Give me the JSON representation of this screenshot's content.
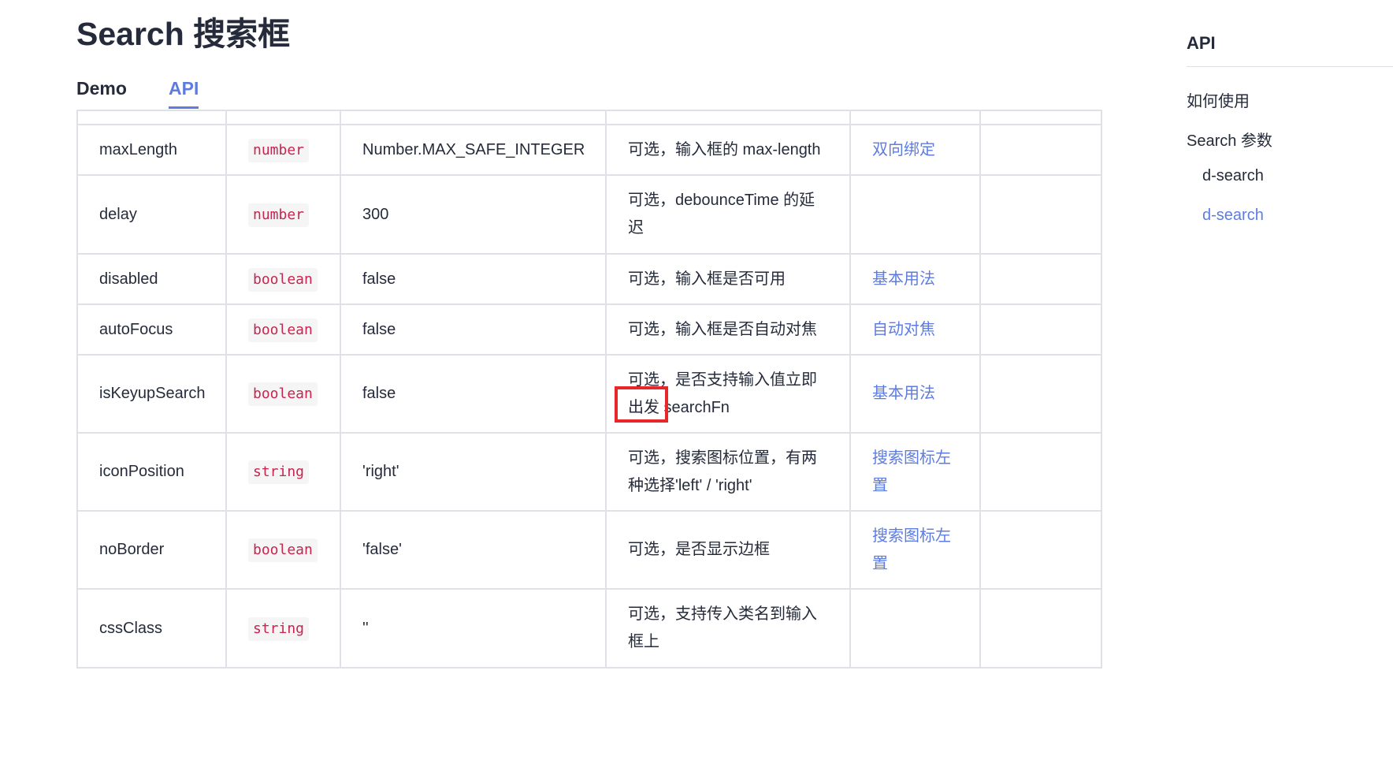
{
  "page": {
    "title": "Search 搜索框"
  },
  "tabs": [
    {
      "label": "Demo",
      "active": false
    },
    {
      "label": "API",
      "active": true
    }
  ],
  "api_table": {
    "rows": [
      {
        "param": "maxLength",
        "type": "number",
        "default": "Number.MAX_SAFE_INTEGER",
        "desc": "可选，输入框的 max-length",
        "demo": "双向绑定"
      },
      {
        "param": "delay",
        "type": "number",
        "default": "300",
        "desc": "可选，debounceTime 的延迟",
        "demo": ""
      },
      {
        "param": "disabled",
        "type": "boolean",
        "default": "false",
        "desc": "可选，输入框是否可用",
        "demo": "基本用法"
      },
      {
        "param": "autoFocus",
        "type": "boolean",
        "default": "false",
        "desc": "可选，输入框是否自动对焦",
        "demo": "自动对焦"
      },
      {
        "param": "isKeyupSearch",
        "type": "boolean",
        "default": "false",
        "desc": "可选，是否支持输入值立即出发 searchFn",
        "demo": "基本用法"
      },
      {
        "param": "iconPosition",
        "type": "string",
        "default": "'right'",
        "desc": "可选，搜索图标位置，有两种选择'left' / 'right'",
        "demo": "搜索图标左置"
      },
      {
        "param": "noBorder",
        "type": "boolean",
        "default": "'false'",
        "desc": "可选，是否显示边框",
        "demo": "搜索图标左置"
      },
      {
        "param": "cssClass",
        "type": "string",
        "default": "''",
        "desc": "可选，支持传入类名到输入框上",
        "demo": ""
      }
    ]
  },
  "toc": {
    "title": "API",
    "items": [
      {
        "label": "如何使用",
        "active": false
      },
      {
        "label": "Search 参数",
        "active": false
      },
      {
        "label": "d-search",
        "active": false
      },
      {
        "label": "d-search",
        "active": true
      }
    ]
  },
  "colors": {
    "accent": "#5e7ce0",
    "code_text": "#c7254e",
    "highlight": "#e8272a"
  }
}
